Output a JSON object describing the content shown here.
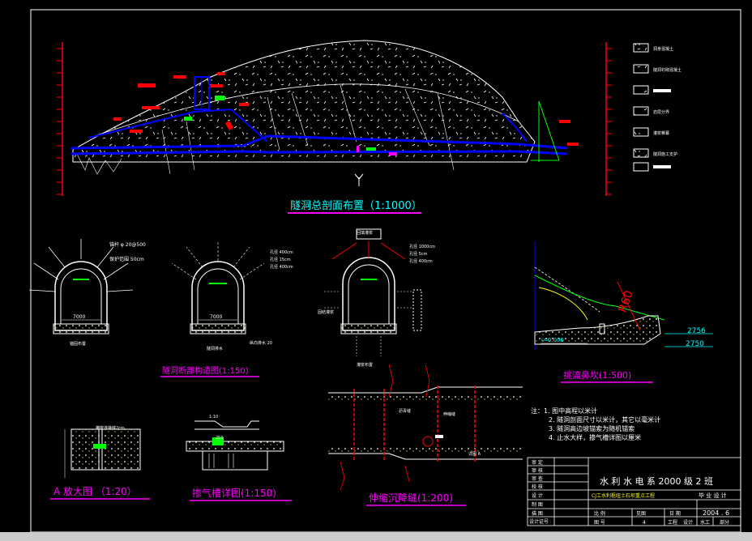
{
  "titles": {
    "main_profile": "隧洞总剖面布置（1:1000）",
    "tunnel_section": "隧洞断部构造图(1:150)",
    "flip_bucket": "挑流鼻坎(1:500)",
    "detail_a": "A 放大图 （1:20）",
    "aeration_slot": "掺气槽详图(1:150)",
    "expansion_joint": "伸缩沉降缝(1:200)"
  },
  "section_labels": {
    "s1_width": "7000",
    "s1_bottom": "锚固布置",
    "s1_bolt": "锚杆 φ 20@500",
    "s1_support": "保护范围 50cm",
    "s2_width": "7000",
    "s2_bottom": "隧洞排水",
    "s2_drain": "纵向排水 20",
    "s2_n1": "孔径 400cm",
    "s2_n2": "孔径 15cm",
    "s2_n3": "孔径 400cm",
    "s3_top": "回填灌浆",
    "s3_left": "固结灌浆",
    "s3_bottom": "灌浆布置",
    "s3_n1": "孔径 1000cm",
    "s3_n2": "孔径 5cm",
    "s3_n3": "孔径 400cm"
  },
  "flip": {
    "radius": "R60",
    "slope": "i=0.006",
    "elev1": "2756",
    "elev2": "2750"
  },
  "detail_a_note": "横管连接缝2cm",
  "joint_labels": {
    "j1": "沥青缝",
    "j2": "伸缩缝",
    "j3": "详图 A"
  },
  "slot_labels": {
    "w1": "1:10",
    "w2": "250"
  },
  "notes": [
    "注：1. 图中高程以米计",
    "2. 隧洞剖面尺寸以米计，其它以毫米计",
    "3. 隧洞高边坡锚索为随机锚索",
    "4. 止水大样，掺气槽详图以厘米"
  ],
  "legend": [
    "洞身混凝土",
    "隧洞衬砌混凝土",
    "",
    "",
    "岩层分界",
    "灌浆帷幕",
    "隧洞施工支护",
    ""
  ],
  "title_block": {
    "left_labels": [
      "审 定",
      "审 核",
      "审 查",
      "校 核",
      "设 计",
      "制 图",
      "描 图",
      "设计证号"
    ],
    "school": "水 利 水 电 系 2000 级 2 班",
    "project": "CJ工水利枢纽土石坝重点工程",
    "phase": "毕 业 设 计",
    "date": "2004 . 6",
    "row1": [
      "比 例",
      "见图",
      "日 期"
    ],
    "row2": [
      "图 号",
      "4",
      "工程",
      "设计",
      "水工",
      "部分"
    ]
  }
}
